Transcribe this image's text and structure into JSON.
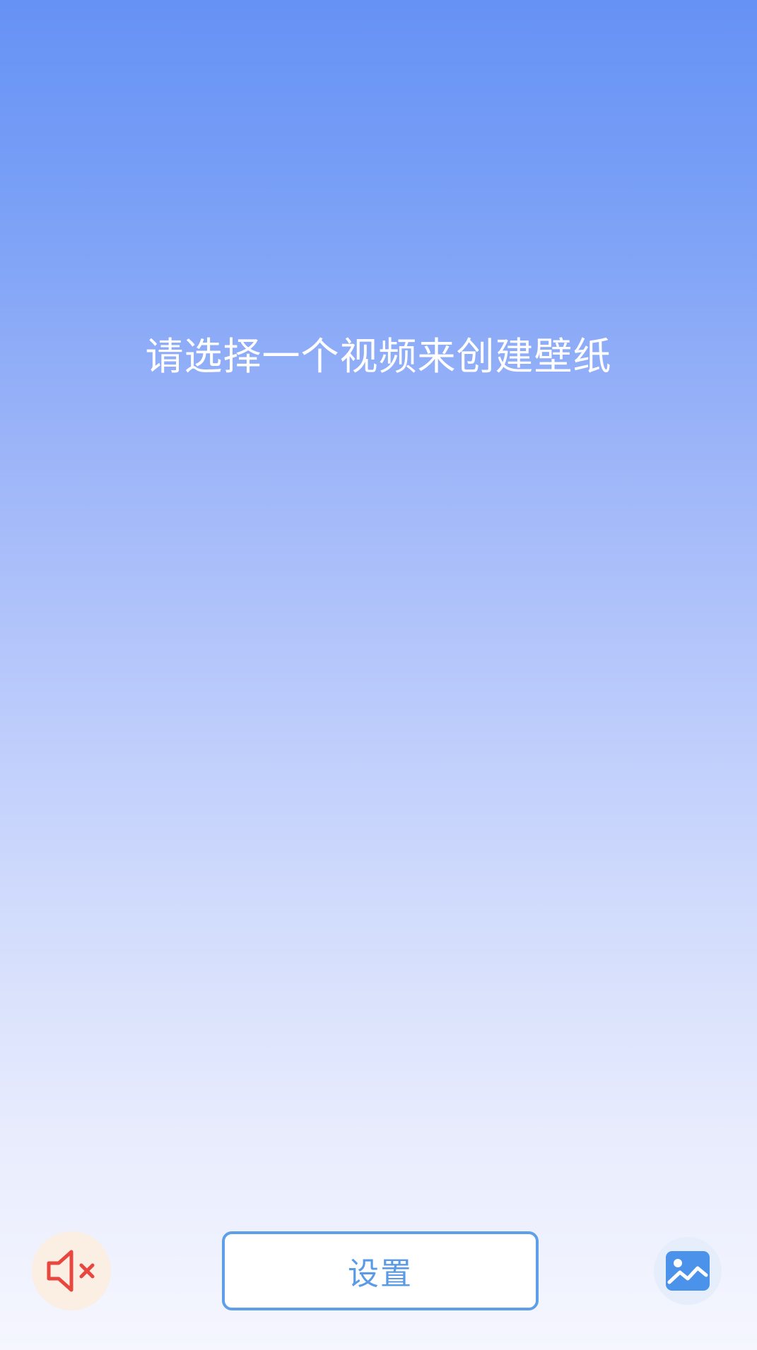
{
  "main": {
    "prompt_text": "请选择一个视频来创建壁纸"
  },
  "bottom_bar": {
    "mute_icon": "speaker-muted-icon",
    "settings_label": "设置",
    "gallery_icon": "image-gallery-icon"
  },
  "colors": {
    "gradient_top": "#6692f5",
    "gradient_bottom": "#f5f6fe",
    "accent_blue": "#5b9be6",
    "mute_red": "#e8473f",
    "mute_bg": "#fbeee3"
  }
}
